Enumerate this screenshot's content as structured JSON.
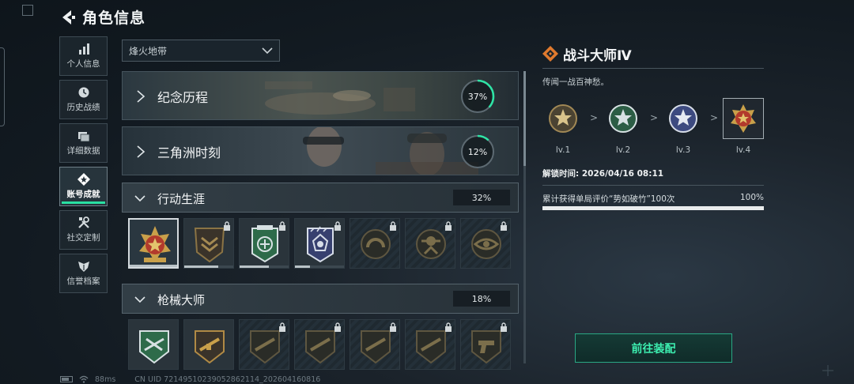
{
  "header": {
    "title": "角色信息"
  },
  "sidebar": {
    "items": [
      {
        "label": "个人信息",
        "icon": "bar-chart-icon"
      },
      {
        "label": "历史战绩",
        "icon": "clock-icon"
      },
      {
        "label": "详细数据",
        "icon": "folder-icon"
      },
      {
        "label": "账号成就",
        "icon": "diamond-star-icon",
        "active": true
      },
      {
        "label": "社交定制",
        "icon": "tools-icon"
      },
      {
        "label": "信誉档案",
        "icon": "shield-wing-icon"
      }
    ]
  },
  "filter": {
    "selected": "烽火地带"
  },
  "categories": {
    "memorial": {
      "name": "纪念历程",
      "percent": "37%",
      "progress": 0.37
    },
    "delta": {
      "name": "三角洲时刻",
      "percent": "12%",
      "progress": 0.12
    },
    "career": {
      "name": "行动生涯",
      "percent": "32%"
    },
    "gunmaster": {
      "name": "枪械大师",
      "percent": "18%"
    }
  },
  "career_badges": [
    {
      "state": "selected",
      "theme": "gold-star",
      "progress": 1.0
    },
    {
      "state": "unlocked",
      "theme": "dark-gold-chevron",
      "progress": 0.7
    },
    {
      "state": "unlocked",
      "theme": "green-emblem",
      "progress": 0.6
    },
    {
      "state": "unlocked",
      "theme": "blue-emblem",
      "progress": 0.3
    },
    {
      "state": "locked",
      "theme": "dark-horseshoe",
      "progress": 0
    },
    {
      "state": "locked",
      "theme": "dark-soldier",
      "progress": 0
    },
    {
      "state": "locked",
      "theme": "dark-eye",
      "progress": 0
    }
  ],
  "gun_badges": [
    {
      "state": "unlocked",
      "theme": "green-rifle"
    },
    {
      "state": "unlocked",
      "theme": "gold-rifle"
    },
    {
      "state": "locked",
      "theme": "dark-rifle"
    },
    {
      "state": "locked",
      "theme": "dark-rifle"
    },
    {
      "state": "locked",
      "theme": "dark-rifle"
    },
    {
      "state": "locked",
      "theme": "dark-rifle"
    },
    {
      "state": "locked",
      "theme": "dark-pistol"
    }
  ],
  "detail": {
    "title": "战斗大师Ⅳ",
    "description": "传闻一战百神愁。",
    "levels": [
      {
        "label": "lv.1"
      },
      {
        "label": "lv.2"
      },
      {
        "label": "lv.3"
      },
      {
        "label": "lv.4",
        "current": true
      }
    ],
    "unlock_time": "解锁时间: 2026/04/16 08:11",
    "task": "累计获得单局评价“势如破竹”100次",
    "task_percent": "100%",
    "task_progress": 1.0,
    "equip_label": "前往装配"
  },
  "footer": {
    "ping": "88ms",
    "uid": "CN UID 7214951023905286211​4_202604160816"
  },
  "colors": {
    "accent": "#29e0a2",
    "ring": "#2fe3a5",
    "gold": "#c9a04a"
  }
}
